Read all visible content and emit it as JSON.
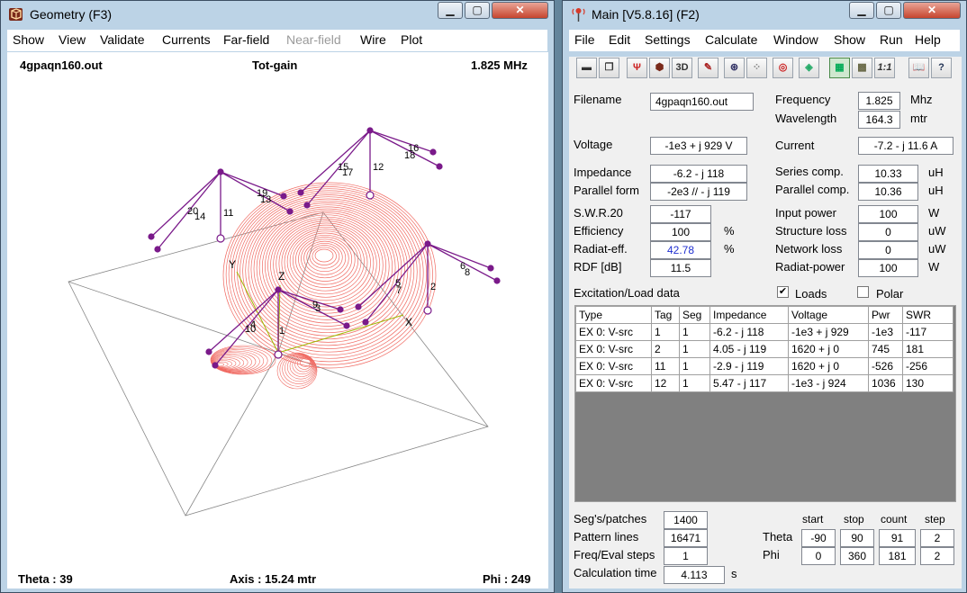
{
  "geometry_window": {
    "title": "Geometry   (F3)",
    "menu": [
      "Show",
      "View",
      "Validate",
      "Currents",
      "Far-field",
      "Near-field",
      "Wire",
      "Plot"
    ],
    "disabled_menu": [
      "Near-field"
    ],
    "filename": "4gpaqn160.out",
    "plot_title": "Tot-gain",
    "frequency": "1.825 MHz",
    "theta": "Theta : 39",
    "axis": "Axis : 15.24 mtr",
    "phi": "Phi : 249",
    "axis_labels": [
      "X",
      "Y",
      "Z"
    ],
    "wire_labels": [
      "1",
      "2",
      "3",
      "4",
      "5",
      "6",
      "7",
      "8",
      "9",
      "10",
      "11",
      "12",
      "13",
      "14",
      "15",
      "16",
      "17",
      "18",
      "19",
      "20"
    ],
    "colors": {
      "pattern": "#f06a62",
      "wires": "#7a1a8a",
      "axes": "#a0b800",
      "ground": "#888888"
    }
  },
  "main_window": {
    "title": "Main [V5.8.16]  (F2)",
    "menu": [
      "File",
      "Edit",
      "Settings",
      "Calculate",
      "Window",
      "Show",
      "Run",
      "Help"
    ],
    "toolbar": [
      "open-icon",
      "copy-icon",
      "antenna-icon",
      "geometry-cube-icon",
      "3d-icon",
      "edit-icon",
      "pattern-icon",
      "nearfield-icon",
      "target-icon",
      "optimize-icon",
      "calculator-icon",
      "grid-icon",
      "swr-icon",
      "book-icon",
      "help-icon"
    ],
    "labels": {
      "filename": "Filename",
      "frequency": "Frequency",
      "wavelength": "Wavelength",
      "voltage": "Voltage",
      "current": "Current",
      "impedance": "Impedance",
      "series_comp": "Series comp.",
      "parallel_form": "Parallel form",
      "parallel_comp": "Parallel comp.",
      "swr": "S.W.R.20",
      "input_power": "Input power",
      "efficiency": "Efficiency",
      "structure_loss": "Structure loss",
      "radiat_eff": "Radiat-eff.",
      "network_loss": "Network loss",
      "rdf": "RDF [dB]",
      "radiat_power": "Radiat-power",
      "excitation": "Excitation/Load data",
      "loads": "Loads",
      "polar": "Polar",
      "segs": "Seg's/patches",
      "pattern_lines": "Pattern lines",
      "freq_steps": "Freq/Eval steps",
      "calc_time": "Calculation time",
      "theta": "Theta",
      "phi": "Phi",
      "start": "start",
      "stop": "stop",
      "count": "count",
      "step": "step"
    },
    "values": {
      "filename": "4gpaqn160.out",
      "frequency": "1.825",
      "wavelength": "164.3",
      "voltage": "-1e3 + j 929 V",
      "current": "-7.2 - j 11.6 A",
      "impedance": "-6.2 - j 118",
      "series_comp": "10.33",
      "parallel_form": "-2e3 // - j 119",
      "parallel_comp": "10.36",
      "swr": "-117",
      "input_power": "100",
      "efficiency": "100",
      "structure_loss": "0",
      "radiat_eff": "42.78",
      "network_loss": "0",
      "rdf": "11.5",
      "radiat_power": "100",
      "segs": "1400",
      "pattern_lines": "16471",
      "freq_steps": "1",
      "calc_time": "4.113",
      "theta_start": "-90",
      "theta_stop": "90",
      "theta_count": "91",
      "theta_step": "2",
      "phi_start": "0",
      "phi_stop": "360",
      "phi_count": "181",
      "phi_step": "2"
    },
    "units": {
      "mhz": "Mhz",
      "mtr": "mtr",
      "uh1": "uH",
      "uh2": "uH",
      "w1": "W",
      "pct1": "%",
      "uw1": "uW",
      "pct2": "%",
      "uw2": "uW",
      "w2": "W",
      "s": "s"
    },
    "loads_checked": true,
    "polar_checked": false,
    "excitation_table": {
      "headers": [
        "Type",
        "Tag",
        "Seg",
        "Impedance",
        "Voltage",
        "Pwr",
        "SWR"
      ],
      "rows": [
        [
          "EX 0: V-src",
          "1",
          "1",
          "-6.2 - j 118",
          "-1e3 + j 929",
          "-1e3",
          "-117"
        ],
        [
          "EX 0: V-src",
          "2",
          "1",
          "4.05 - j 119",
          "1620 + j 0",
          "745",
          "181"
        ],
        [
          "EX 0: V-src",
          "11",
          "1",
          "-2.9 - j 119",
          "1620 + j 0",
          "-526",
          "-256"
        ],
        [
          "EX 0: V-src",
          "12",
          "1",
          "5.47 - j 117",
          "-1e3 - j 924",
          "1036",
          "130"
        ]
      ]
    },
    "accent_blue": "#1f2fd0"
  }
}
